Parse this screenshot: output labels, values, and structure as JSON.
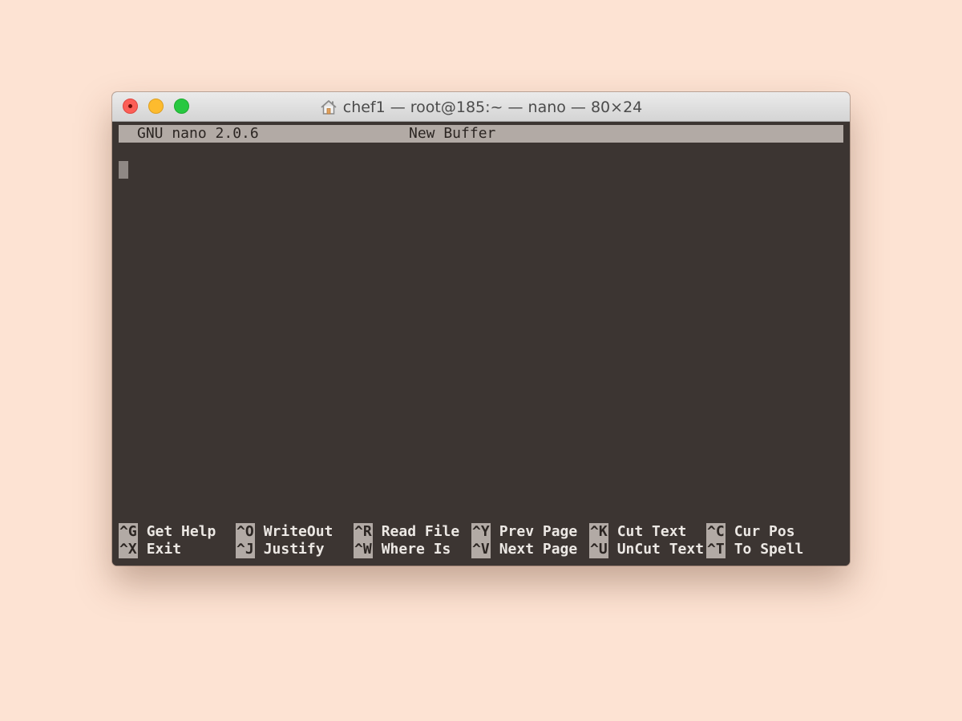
{
  "window": {
    "title": "chef1 — root@185:~ — nano — 80×24"
  },
  "nano": {
    "version": "GNU nano 2.0.6",
    "buffer_name": "New Buffer"
  },
  "shortcuts": {
    "row1": [
      {
        "key": "^G",
        "label": "Get Help"
      },
      {
        "key": "^O",
        "label": "WriteOut"
      },
      {
        "key": "^R",
        "label": "Read File"
      },
      {
        "key": "^Y",
        "label": "Prev Page"
      },
      {
        "key": "^K",
        "label": "Cut Text"
      },
      {
        "key": "^C",
        "label": "Cur Pos"
      }
    ],
    "row2": [
      {
        "key": "^X",
        "label": "Exit"
      },
      {
        "key": "^J",
        "label": "Justify"
      },
      {
        "key": "^W",
        "label": "Where Is"
      },
      {
        "key": "^V",
        "label": "Next Page"
      },
      {
        "key": "^U",
        "label": "UnCut Text"
      },
      {
        "key": "^T",
        "label": "To Spell"
      }
    ]
  },
  "colors": {
    "desktop": "#fde3d3",
    "terminal_bg": "#3c3532",
    "inverse_bg": "#b2aaa5",
    "text": "#ece8e4"
  },
  "icons": {
    "title": "home-icon",
    "close": "close-button",
    "minimize": "minimize-button",
    "zoom": "zoom-button"
  }
}
